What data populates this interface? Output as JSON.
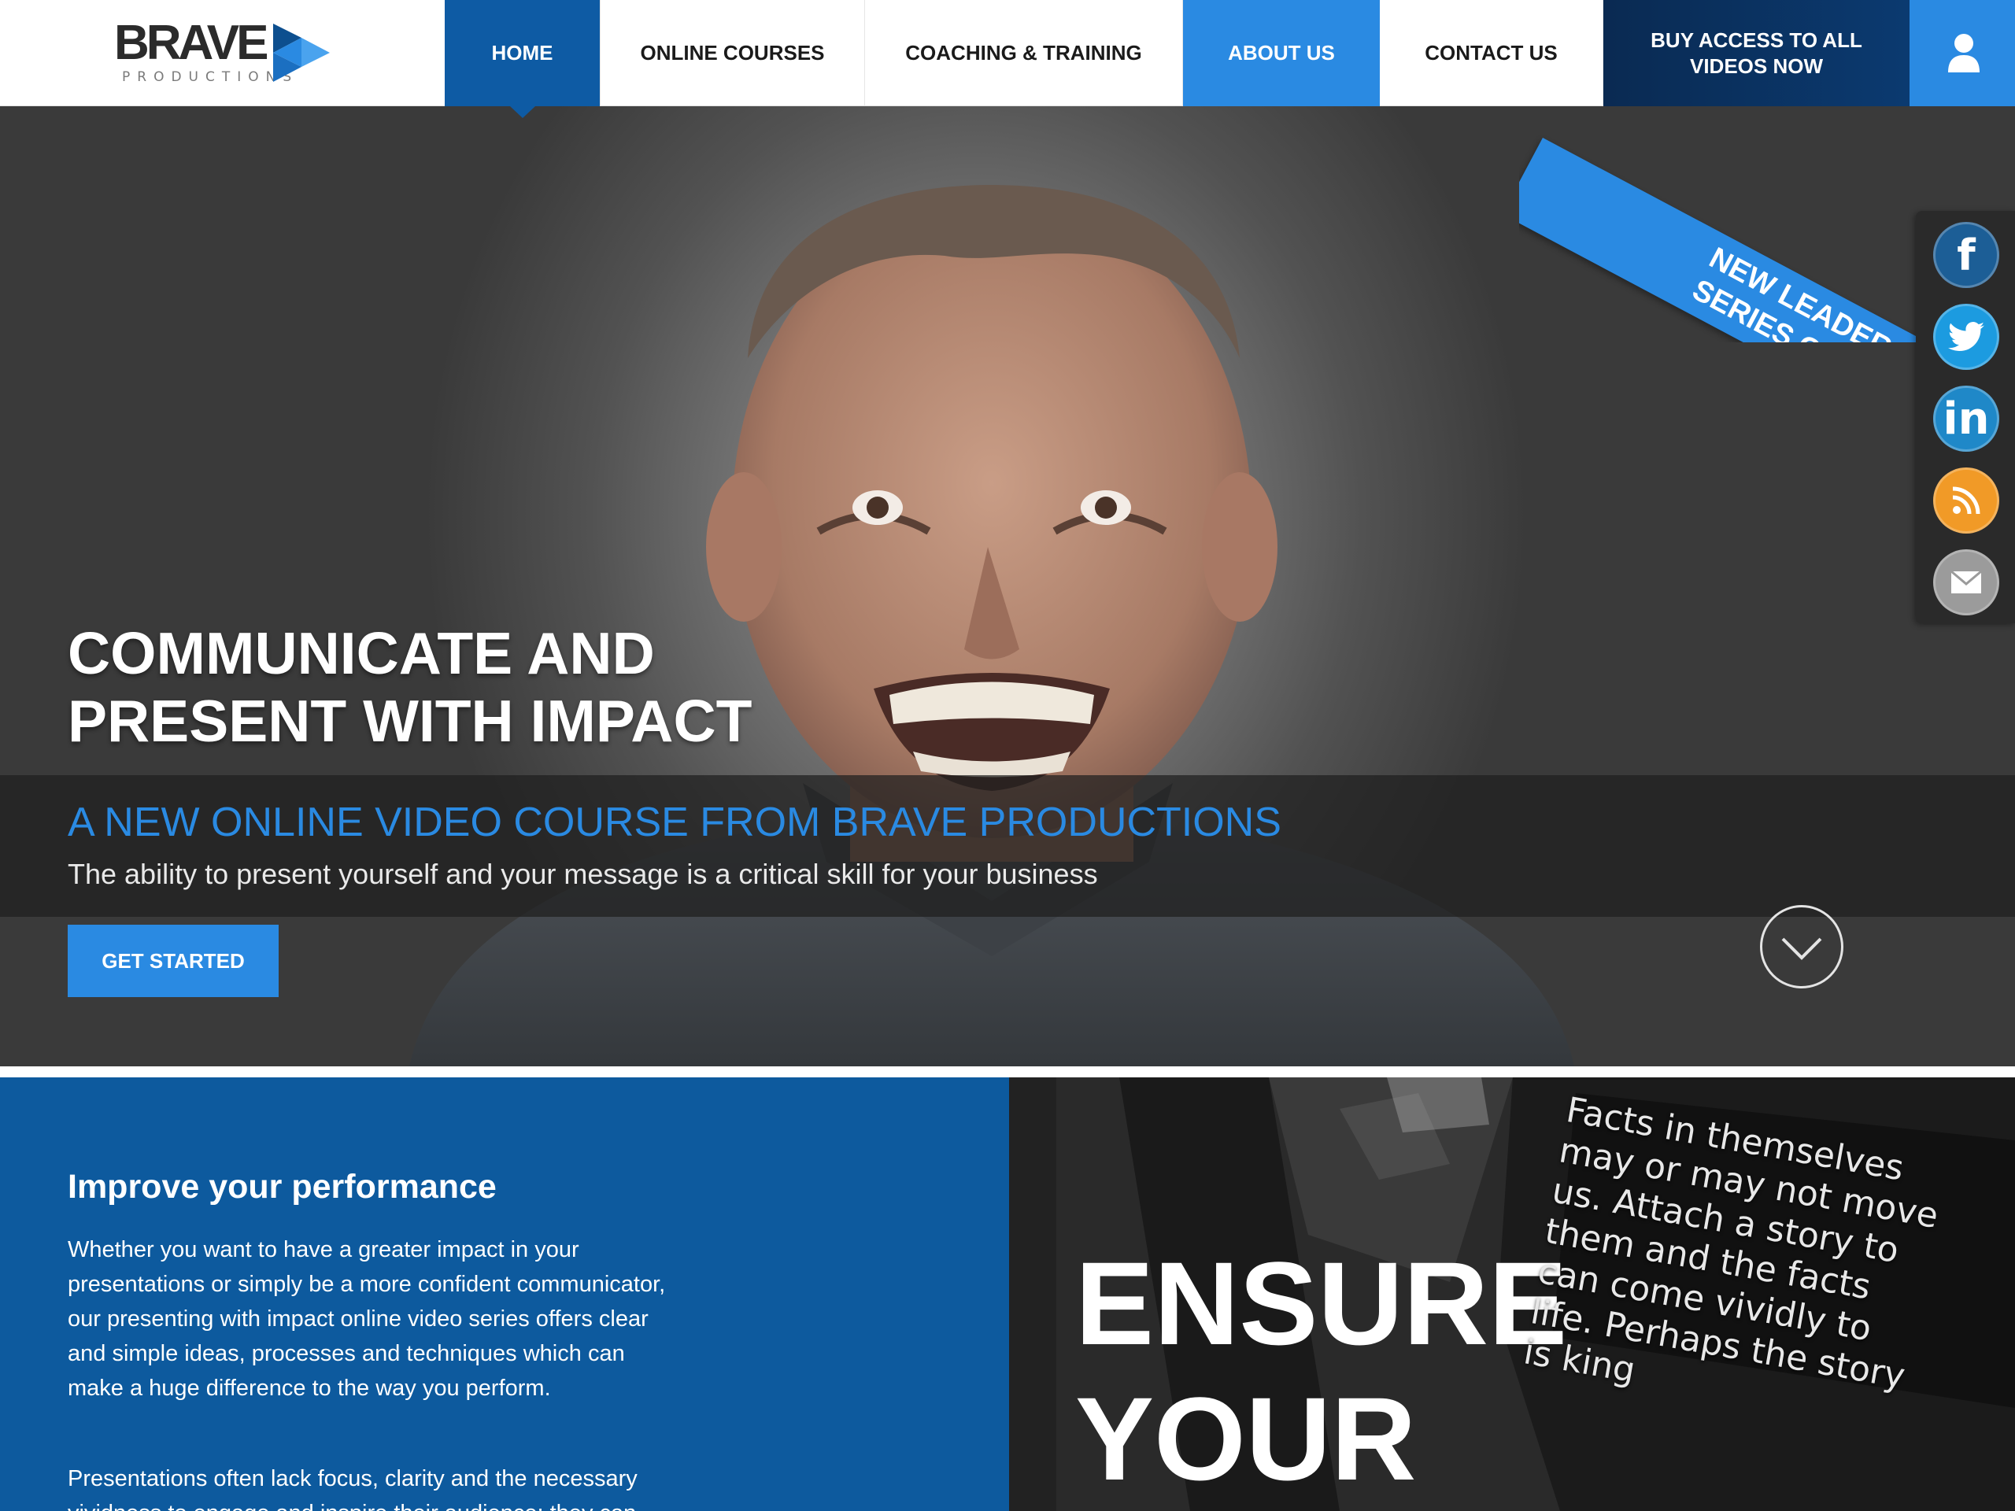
{
  "logo": {
    "wordmark": "BRAVE",
    "tagline": "PRODUCTIONS"
  },
  "nav": {
    "home": "HOME",
    "courses": "ONLINE COURSES",
    "coaching": "COACHING & TRAINING",
    "about": "ABOUT US",
    "contact": "CONTACT US",
    "buy_line1": "BUY ACCESS TO ALL",
    "buy_line2": "VIDEOS NOW",
    "user_icon": "user-icon"
  },
  "hero": {
    "ribbon_line1": "NEW LEADERSHIP",
    "ribbon_line2": "SERIES COMING SOON",
    "headline_line1": "COMMUNICATE AND",
    "headline_line2": "PRESENT WITH IMPACT",
    "subtitle": "A NEW ONLINE VIDEO COURSE FROM BRAVE PRODUCTIONS",
    "description": "The ability to present yourself and your message is a critical skill for your business",
    "cta": "GET STARTED",
    "scroll_icon": "chevron-down-icon"
  },
  "social": [
    "facebook-icon",
    "twitter-icon",
    "linkedin-icon",
    "rss-icon",
    "mail-icon"
  ],
  "performance": {
    "title": "Improve your performance",
    "p1": "Whether you want to have a greater impact in your presentations or simply be a more confident communicator, our presenting with impact online video series offers clear and simple ideas, processes and techniques which can make a huge difference to the way you perform.",
    "p2": "Presentations often lack focus, clarity and the necessary vividness to engage and inspire their audience; they can"
  },
  "promo": {
    "ensure_line1": "ENSURE",
    "ensure_line2": "YOUR",
    "quote": "Facts in themselves may or may not move us. Attach a story to them and the facts can come vividly to life. Perhaps the story is king"
  },
  "colors": {
    "primary_blue": "#0e5ba4",
    "accent_blue": "#2a8ae2",
    "dark_navy": "#0a2a52",
    "panel_blue": "#0d5a9e"
  }
}
